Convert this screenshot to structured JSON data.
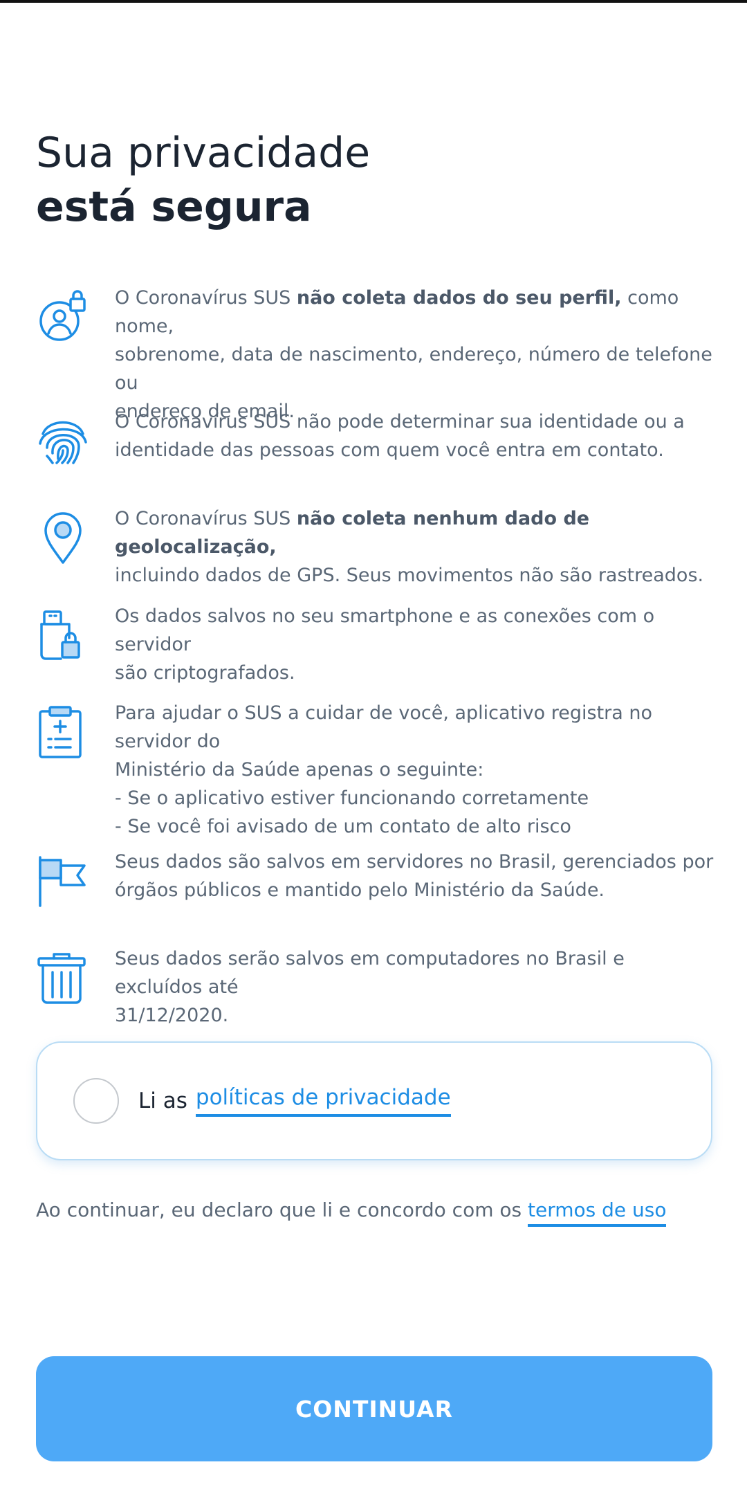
{
  "title": {
    "line1": "Sua privacidade",
    "line2": "está segura"
  },
  "accent_color": "#1d8de4",
  "items": [
    {
      "icon": "user-lock-icon",
      "line1_pre": "O Coronavírus SUS ",
      "line1_bold": "não coleta dados do seu perfil,",
      "line1_post": " como nome,",
      "line2": "sobrenome, data de nascimento, endereço, número de telefone ou",
      "line3": "endereço de email."
    },
    {
      "icon": "fingerprint-icon",
      "line1": "O Coronavírus SUS não pode determinar sua identidade ou a",
      "line2": "identidade das pessoas com quem você entra em contato."
    },
    {
      "icon": "location-pin-icon",
      "line1_pre": "O Coronavírus SUS ",
      "line1_bold": "não coleta nenhum dado de geolocalização,",
      "line2": "incluindo dados de GPS. Seus movimentos não são rastreados."
    },
    {
      "icon": "usb-lock-icon",
      "line1": "Os dados salvos no seu smartphone e as conexões com o servidor",
      "line2": "são criptografados."
    },
    {
      "icon": "clipboard-medical-icon",
      "line1": "Para ajudar o SUS a cuidar de você, aplicativo registra no servidor do",
      "line2": "Ministério da Saúde apenas o seguinte:",
      "line3": "- Se o aplicativo estiver funcionando corretamente",
      "line4": "- Se você foi avisado de um contato de alto risco"
    },
    {
      "icon": "flag-icon",
      "line1": "Seus dados são salvos em servidores no Brasil, gerenciados por",
      "line2": "órgãos públicos e mantido pelo Ministério da Saúde."
    },
    {
      "icon": "trash-icon",
      "line1": "Seus dados serão salvos em computadores no Brasil e excluídos até",
      "line2": "31/12/2020."
    }
  ],
  "consent": {
    "checked": false,
    "label": "Li as",
    "link": "políticas de privacidade"
  },
  "terms": {
    "text": "Ao continuar, eu declaro que li e concordo com os",
    "link": "termos de uso"
  },
  "continue_button": "CONTINUAR"
}
